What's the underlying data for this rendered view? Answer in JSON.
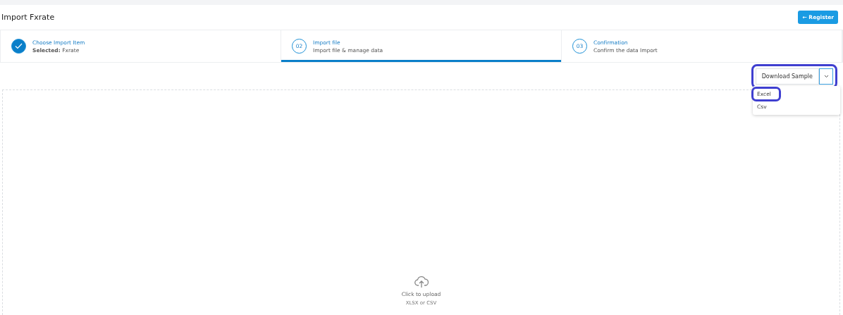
{
  "header": {
    "title": "Import Fxrate",
    "register_button": {
      "label": "← Register"
    }
  },
  "steps": [
    {
      "kind": "done",
      "title": "Choose Import Item",
      "subtitle_label": "Selected:",
      "subtitle": "Fxrate",
      "selected": false
    },
    {
      "kind": "numbered",
      "number": "02",
      "title": "Import file",
      "subtitle": "Import file & manage data",
      "selected": true
    },
    {
      "kind": "numbered",
      "number": "03",
      "title": "Confirmation",
      "subtitle": "Confirm the data Import",
      "selected": false
    }
  ],
  "download": {
    "label": "Download Sample",
    "highlighted": true,
    "expanded": true,
    "menu": [
      {
        "label": "Excel",
        "highlighted": true
      },
      {
        "label": "Csv",
        "highlighted": false
      }
    ]
  },
  "upload": {
    "label": "Click to upload",
    "hint": "XLSX or CSV"
  }
}
